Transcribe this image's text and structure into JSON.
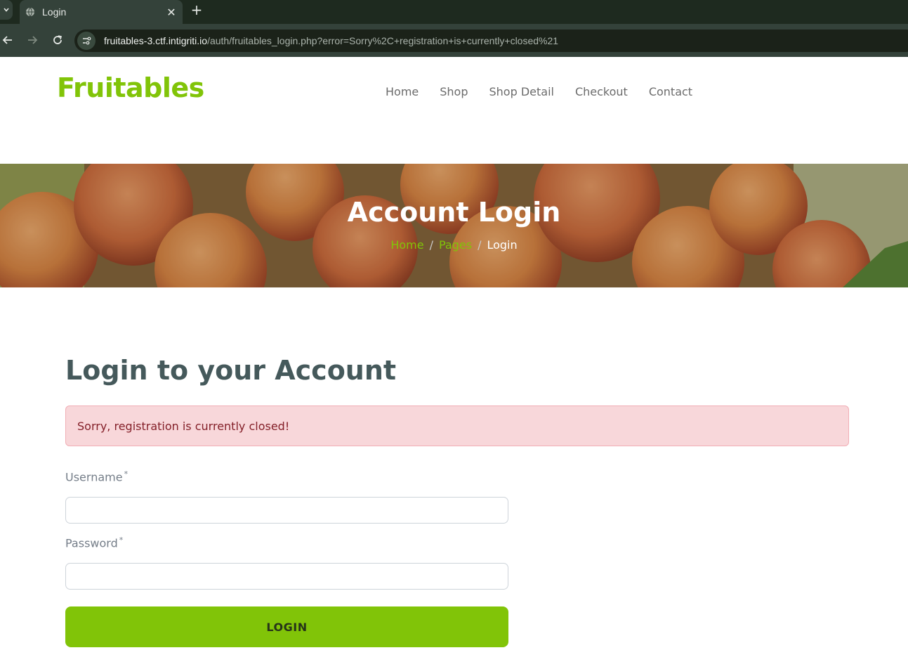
{
  "browser": {
    "tab_title": "Login",
    "url_host": "fruitables-3.ctf.intigriti.io",
    "url_path": "/auth/fruitables_login.php?error=Sorry%2C+registration+is+currently+closed%21"
  },
  "header": {
    "brand": "Fruitables",
    "nav": [
      "Home",
      "Shop",
      "Shop Detail",
      "Checkout",
      "Contact"
    ]
  },
  "hero": {
    "title": "Account Login",
    "breadcrumb": [
      "Home",
      "Pages",
      "Login"
    ]
  },
  "main": {
    "heading": "Login to your Account",
    "alert": "Sorry, registration is currently closed!",
    "username_label": "Username",
    "password_label": "Password",
    "required_mark": "*",
    "submit_label": "LOGIN"
  },
  "colors": {
    "brand": "#81c408",
    "heading": "#45595b",
    "alert_bg": "#f8d7da",
    "alert_text": "#842029"
  }
}
